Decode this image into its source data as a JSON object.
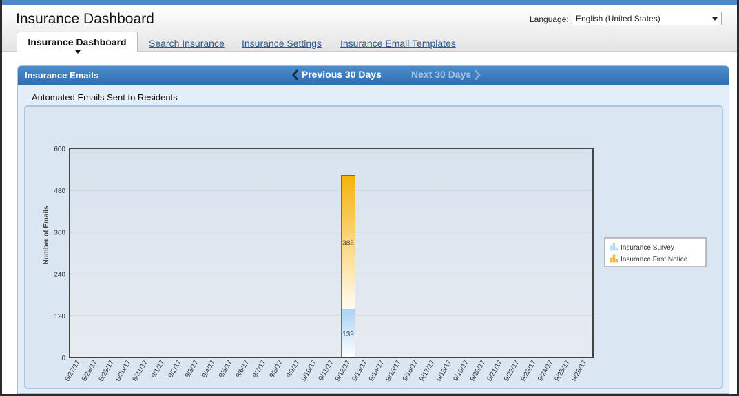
{
  "header": {
    "title": "Insurance Dashboard",
    "language_label": "Language:",
    "language_value": "English (United States)"
  },
  "tabs": [
    {
      "label": "Insurance Dashboard",
      "active": true
    },
    {
      "label": "Search Insurance"
    },
    {
      "label": "Insurance Settings"
    },
    {
      "label": "Insurance Email Templates"
    }
  ],
  "panel": {
    "title": "Insurance Emails",
    "prev_label": "Previous 30 Days",
    "next_label": "Next 30 Days",
    "subtitle": "Automated Emails Sent to Residents"
  },
  "colors": {
    "survey_top": "#ffffff",
    "survey_bottom": "#a9d3f5",
    "notice_top": "#f6b20c",
    "notice_bottom": "#fffcf2",
    "plot_bg": "#e7ebf1",
    "grid": "#b5b8bc",
    "accent": "#2d6cb0"
  },
  "chart_data": {
    "type": "bar",
    "stacked": true,
    "xlabel": "Date",
    "ylabel": "Number of Emails",
    "ylim": [
      0,
      600
    ],
    "yticks": [
      0,
      120,
      240,
      360,
      480,
      600
    ],
    "grid": true,
    "legend_position": "right",
    "categories": [
      "8/27/17",
      "8/28/17",
      "8/29/17",
      "8/30/17",
      "8/31/17",
      "9/1/17",
      "9/2/17",
      "9/3/17",
      "9/4/17",
      "9/5/17",
      "9/6/17",
      "9/7/17",
      "9/8/17",
      "9/9/17",
      "9/10/17",
      "9/11/17",
      "9/12/17",
      "9/13/17",
      "9/14/17",
      "9/15/17",
      "9/16/17",
      "9/17/17",
      "9/18/17",
      "9/19/17",
      "9/20/17",
      "9/21/17",
      "9/22/17",
      "9/23/17",
      "9/24/17",
      "9/25/17",
      "9/26/17"
    ],
    "series": [
      {
        "name": "Insurance Survey",
        "values": [
          0,
          0,
          0,
          0,
          0,
          0,
          0,
          0,
          0,
          0,
          0,
          0,
          0,
          0,
          0,
          0,
          139,
          0,
          0,
          0,
          0,
          0,
          0,
          0,
          0,
          0,
          0,
          0,
          0,
          0,
          0
        ]
      },
      {
        "name": "Insurance First Notice",
        "values": [
          0,
          0,
          0,
          0,
          0,
          0,
          0,
          0,
          0,
          0,
          0,
          0,
          0,
          0,
          0,
          0,
          383,
          0,
          0,
          0,
          0,
          0,
          0,
          0,
          0,
          0,
          0,
          0,
          0,
          0,
          0
        ]
      }
    ]
  }
}
